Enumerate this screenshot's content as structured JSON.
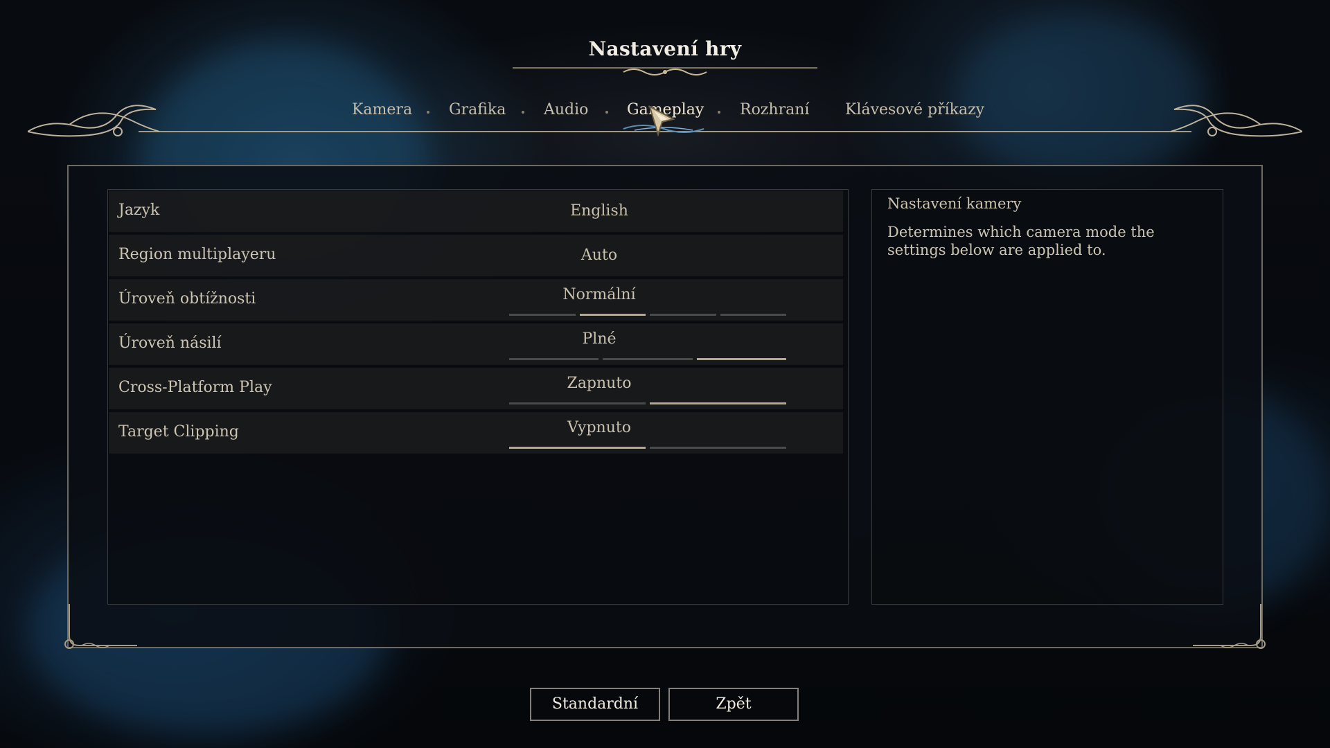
{
  "title": "Nastavení hry",
  "tabs": [
    {
      "label": "Kamera",
      "active": false
    },
    {
      "label": "Grafika",
      "active": false
    },
    {
      "label": "Audio",
      "active": false
    },
    {
      "label": "Gameplay",
      "active": true
    },
    {
      "label": "Rozhraní",
      "active": false
    },
    {
      "label": "Klávesové příkazy",
      "active": false
    }
  ],
  "settings": [
    {
      "label": "Jazyk",
      "value": "English",
      "type": "select"
    },
    {
      "label": "Region multiplayeru",
      "value": "Auto",
      "type": "select"
    },
    {
      "label": "Úroveň obtížnosti",
      "value": "Normální",
      "type": "stepper",
      "options_count": 4,
      "selected_index": 1
    },
    {
      "label": "Úroveň násilí",
      "value": "Plné",
      "type": "stepper",
      "options_count": 3,
      "selected_index": 2
    },
    {
      "label": "Cross-Platform Play",
      "value": "Zapnuto",
      "type": "toggle",
      "options_count": 2,
      "selected_index": 1
    },
    {
      "label": "Target Clipping",
      "value": "Vypnuto",
      "type": "toggle",
      "options_count": 2,
      "selected_index": 0
    }
  ],
  "description": {
    "title": "Nastavení kamery",
    "text": "Determines which camera mode the settings below are applied to."
  },
  "buttons": {
    "default_label": "Standardní",
    "back_label": "Zpět"
  },
  "colors": {
    "accent": "#b8a88c",
    "segment_off": "#4a4a48",
    "border": "#6d6a63"
  }
}
